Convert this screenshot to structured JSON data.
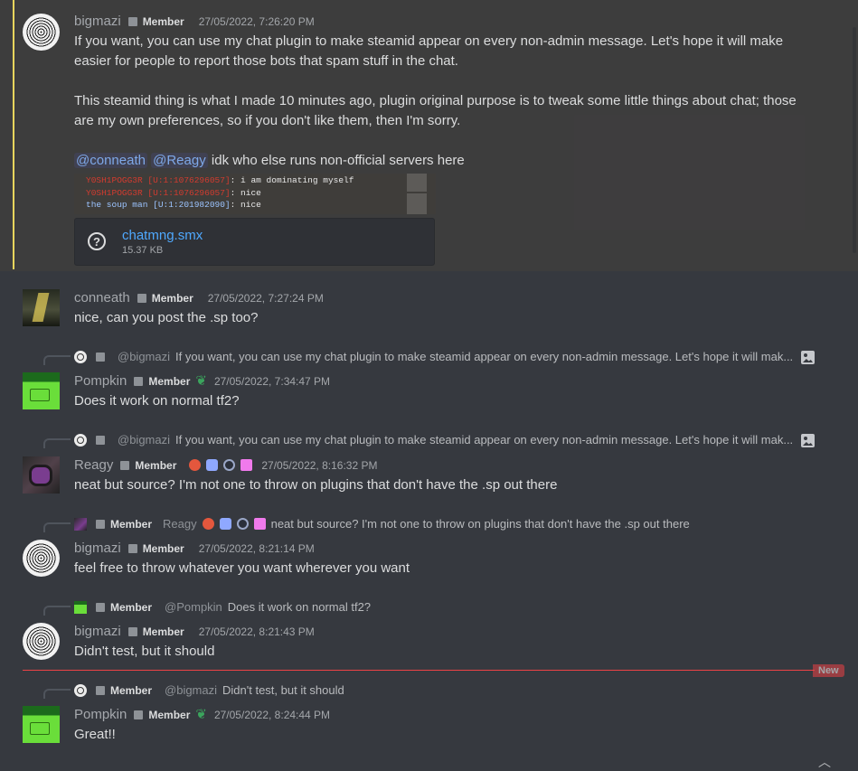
{
  "messages": [
    {
      "id": "m1",
      "author": "bigmazi",
      "role": "Member",
      "timestamp": "27/05/2022, 7:26:20 PM",
      "lines": [
        "If you want, you can use my chat plugin to make steamid appear on every non-admin message. Let's hope it will make easier for people to report those bots that spam stuff in the chat.",
        "This steamid thing is what I made 10 minutes ago, plugin original purpose is to tweak some little things about chat; those are my own preferences, so if you don't like them, then I'm sorry."
      ],
      "mentions": [
        "@conneath",
        "@Reagy"
      ],
      "mention_tail": "idk who else runs non-official servers here",
      "screenshot_lines": [
        {
          "name": "Y0SH1POGG3R [U:1:1076296057]",
          "text": ": i am dominating myself"
        },
        {
          "name": "Y0SH1POGG3R [U:1:1076296057]",
          "text": ": nice"
        },
        {
          "name": "the soup man [U:1:201982090]",
          "text": ": nice"
        }
      ],
      "attachment": {
        "filename": "chatmng.smx",
        "size": "15.37 KB"
      }
    },
    {
      "id": "m2",
      "author": "conneath",
      "role": "Member",
      "timestamp": "27/05/2022, 7:27:24 PM",
      "text": "nice, can you post the .sp too?"
    },
    {
      "id": "m3",
      "reply": {
        "mention": "@bigmazi",
        "text": "If you want, you can use my chat plugin to make steamid appear on every non-admin message. Let's hope it will mak..."
      },
      "author": "Pompkin",
      "role": "Member",
      "timestamp": "27/05/2022, 7:34:47 PM",
      "text": "Does it work on normal tf2?"
    },
    {
      "id": "m4",
      "reply": {
        "mention": "@bigmazi",
        "text": "If you want, you can use my chat plugin to make steamid appear on every non-admin message. Let's hope it will mak..."
      },
      "author": "Reagy",
      "role": "Member",
      "timestamp": "27/05/2022, 8:16:32 PM",
      "text": "neat but source? I'm not one to throw on plugins that don't have the .sp out there"
    },
    {
      "id": "m5",
      "reply": {
        "role": "Member",
        "name": "Reagy",
        "text": "neat but source? I'm not one to throw on plugins that don't have the .sp out there"
      },
      "author": "bigmazi",
      "role": "Member",
      "timestamp": "27/05/2022, 8:21:14 PM",
      "text": "feel free to throw whatever you want wherever you want"
    },
    {
      "id": "m6",
      "reply": {
        "role": "Member",
        "mention": "@Pompkin",
        "text": "Does it work on normal tf2?"
      },
      "author": "bigmazi",
      "role": "Member",
      "timestamp": "27/05/2022, 8:21:43 PM",
      "text": "Didn't test, but it should"
    },
    {
      "id": "m7",
      "reply": {
        "role": "Member",
        "mention": "@bigmazi",
        "text": "Didn't test, but it should"
      },
      "author": "Pompkin",
      "role": "Member",
      "timestamp": "27/05/2022, 8:24:44 PM",
      "text": "Great!!"
    }
  ],
  "new_divider_label": "New",
  "colors": {
    "background": "#36393f",
    "mention": "#7ea8e8",
    "link": "#4fa9ff",
    "new_divider": "#ed4245",
    "highlight_bar": "#e8d55d"
  },
  "icons": {
    "attachment_unknown": "question-circle-icon",
    "reply_image": "image-icon",
    "badge_sprout": "sprout-icon",
    "scroll_down": "chevron-up-icon"
  }
}
